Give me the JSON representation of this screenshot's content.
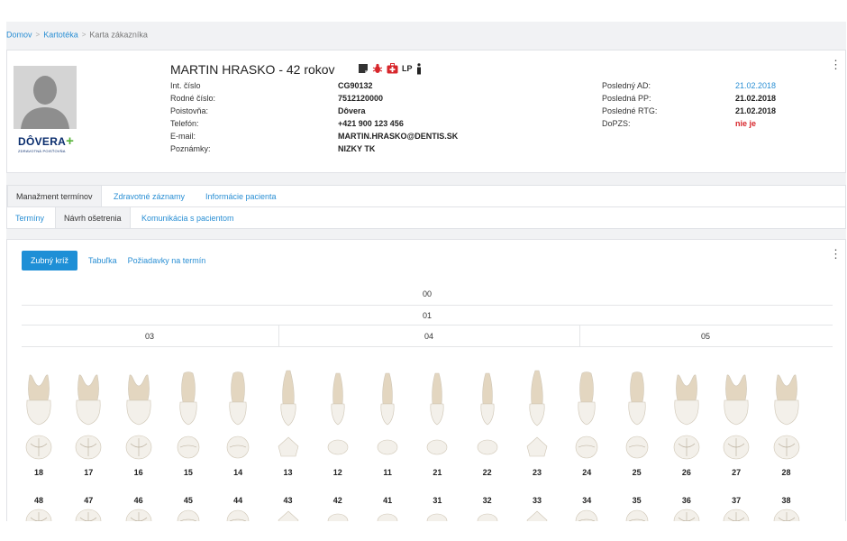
{
  "breadcrumb": {
    "home": "Domov",
    "registry": "Kartotéka",
    "current": "Karta zákazníka"
  },
  "patient": {
    "name_age": "MARTIN HRASKO - 42 rokov",
    "alert_lp": "LP",
    "insurer_logo_name": "DÔVERA",
    "insurer_logo_sub": "ZDRAVOTNÁ POISŤOVŇA",
    "fields": [
      {
        "label": "Int. číslo",
        "value": "CG90132"
      },
      {
        "label": "Rodné číslo:",
        "value": "7512120000"
      },
      {
        "label": "Poistovňa:",
        "value": "Dôvera"
      },
      {
        "label": "Telefón:",
        "value": "+421 900 123 456"
      },
      {
        "label": "E-mail:",
        "value": "MARTIN.HRASKO@DENTIS.SK"
      },
      {
        "label": "Poznámky:",
        "value": "NIZKY TK"
      }
    ],
    "dates": [
      {
        "label": "Posledný AD:",
        "value": "21.02.2018"
      },
      {
        "label": "Posledná PP:",
        "value": "21.02.2018"
      },
      {
        "label": "Posledné RTG:",
        "value": "21.02.2018"
      },
      {
        "label": "DoPZS:",
        "value": "nie je"
      }
    ]
  },
  "tabs_main": [
    "Manažment termínov",
    "Zdravotné záznamy",
    "Informácie pacienta"
  ],
  "tabs_sub": [
    "Termíny",
    "Návrh ošetrenia",
    "Komunikácia s pacientom"
  ],
  "chart_nav": {
    "active": "Zubný kríž",
    "table": "Tabuľka",
    "requests": "Požiadavky na termín"
  },
  "dental_chart": {
    "row_00": "00",
    "row_01": "01",
    "segments": [
      "03",
      "04",
      "05"
    ],
    "upper_teeth": [
      "18",
      "17",
      "16",
      "15",
      "14",
      "13",
      "12",
      "11",
      "21",
      "22",
      "23",
      "24",
      "25",
      "26",
      "27",
      "28"
    ],
    "lower_teeth": [
      "48",
      "47",
      "46",
      "45",
      "44",
      "43",
      "42",
      "41",
      "31",
      "32",
      "33",
      "34",
      "35",
      "36",
      "37",
      "38"
    ]
  },
  "colors": {
    "accent": "#1e8fd6",
    "link": "#2a8fd4",
    "danger": "#d7262b",
    "tooth_enamel": "#f3f0ea",
    "tooth_root": "#e3d6c0"
  }
}
